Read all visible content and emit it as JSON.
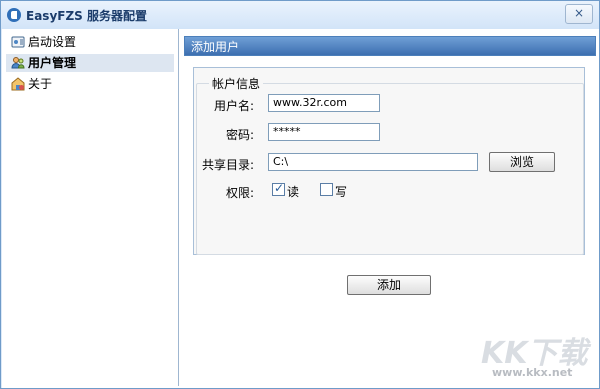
{
  "window": {
    "title": "EasyFZS 服务器配置",
    "close_glyph": "×"
  },
  "sidebar": {
    "items": [
      {
        "label": "启动设置",
        "icon": "startup-icon"
      },
      {
        "label": "用户管理",
        "icon": "users-icon",
        "active": true
      },
      {
        "label": "关于",
        "icon": "about-icon"
      }
    ]
  },
  "main": {
    "header": "添加用户",
    "group_title": "帐户信息",
    "fields": {
      "username_label": "用户名:",
      "username_value": "www.32r.com",
      "password_label": "密码:",
      "password_value": "*****",
      "shared_dir_label": "共享目录:",
      "shared_dir_value": "C:\\",
      "browse_button": "浏览",
      "permission_label": "权限:",
      "read_label": "读",
      "read_checked": true,
      "write_label": "写",
      "write_checked": false
    },
    "add_button": "添加"
  },
  "watermark": {
    "logo_text": "KK下载",
    "url": "www.kkx.net"
  }
}
